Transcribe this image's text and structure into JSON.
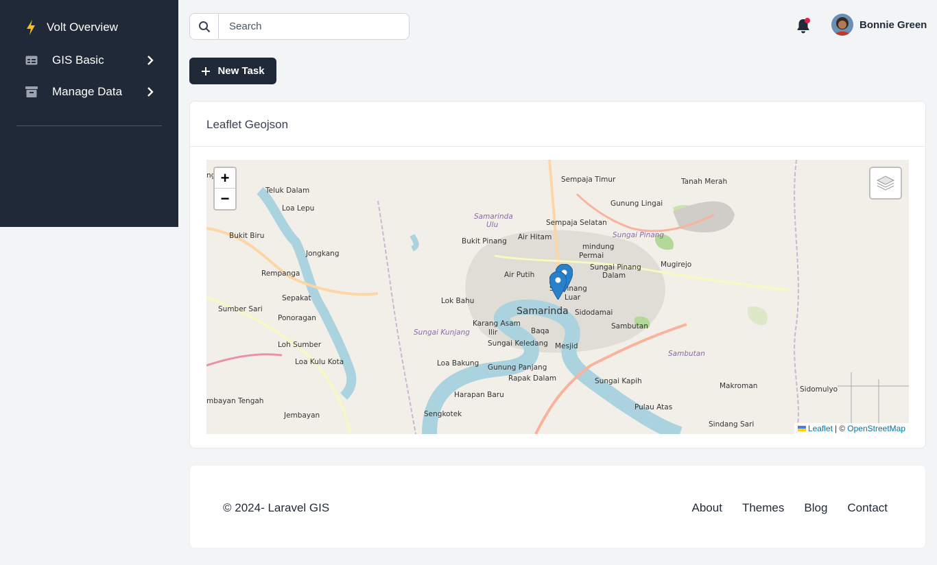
{
  "sidebar": {
    "brand": "Volt Overview",
    "items": [
      {
        "label": "GIS Basic",
        "icon": "table-icon"
      },
      {
        "label": "Manage Data",
        "icon": "archive-icon"
      }
    ]
  },
  "header": {
    "search_placeholder": "Search",
    "user_name": "Bonnie Green"
  },
  "toolbar": {
    "new_task_label": "New Task"
  },
  "card": {
    "title": "Leaflet Geojson",
    "map": {
      "place_labels": [
        {
          "text": "Teluk Dalam"
        },
        {
          "text": "Loa Lepu"
        },
        {
          "text": "Bukit Biru"
        },
        {
          "text": "Jongkang"
        },
        {
          "text": "Rempanga"
        },
        {
          "text": "Sepakat"
        },
        {
          "text": "Sumber Sari"
        },
        {
          "text": "Ponoragan"
        },
        {
          "text": "Loh Sumber"
        },
        {
          "text": "Loa Kulu Kota"
        },
        {
          "text": "mbayan Tengah"
        },
        {
          "text": "Jembayan"
        },
        {
          "text": "Sempaja Timur"
        },
        {
          "text": "Gunung Lingai"
        },
        {
          "text": "Sempaja Selatan"
        },
        {
          "text": "Tanah Merah"
        },
        {
          "text": "Bukit Pinang"
        },
        {
          "text": "Air Hitam"
        },
        {
          "text": "Samarinda"
        },
        {
          "text": "Ulu"
        },
        {
          "text": "Sungai Pinang"
        },
        {
          "text": "mindung"
        },
        {
          "text": "Permai"
        },
        {
          "text": "Sungai Pinang"
        },
        {
          "text": "Dalam"
        },
        {
          "text": "Mugirejo"
        },
        {
          "text": "Air Putih"
        },
        {
          "text": "Lok Bahu"
        },
        {
          "text": "Samarinda"
        },
        {
          "text": "Sidodamai"
        },
        {
          "text": "Karang Asam"
        },
        {
          "text": "Ilir"
        },
        {
          "text": "Sungai Kunjang"
        },
        {
          "text": "Baqa"
        },
        {
          "text": "Sambutan"
        },
        {
          "text": "Sungai Keledang"
        },
        {
          "text": "Mesjid"
        },
        {
          "text": "Sambutan"
        },
        {
          "text": "Loa Bakung"
        },
        {
          "text": "Gunung Panjang"
        },
        {
          "text": "Rapak Dalam"
        },
        {
          "text": "Sungai Kapih"
        },
        {
          "text": "Makroman"
        },
        {
          "text": "Sidomulyo"
        },
        {
          "text": "Harapan Baru"
        },
        {
          "text": "Sengkotek"
        },
        {
          "text": "Pulau Atas"
        },
        {
          "text": "Sindang Sari"
        },
        {
          "text": "Sei Pinang"
        },
        {
          "text": "Luar"
        },
        {
          "text": "ngjang"
        }
      ],
      "attribution": {
        "leaflet": "Leaflet",
        "separator": "| ©",
        "osm": "OpenStreetMap"
      },
      "zoom_in": "+",
      "zoom_out": "−"
    }
  },
  "footer": {
    "copyright": "© 2024- Laravel GIS",
    "links": [
      "About",
      "Themes",
      "Blog",
      "Contact"
    ]
  },
  "colors": {
    "sidebar_bg": "#1f2937",
    "bolt": "#fbbf24",
    "notification_dot": "#e11d48",
    "marker": "#2a81cb"
  }
}
